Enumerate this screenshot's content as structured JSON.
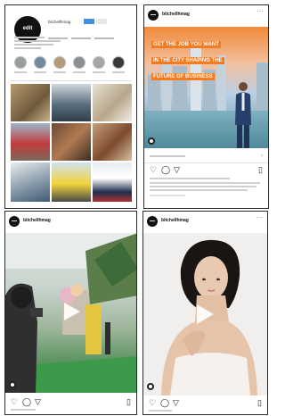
{
  "panels": {
    "profile": {
      "avatar_text": "edit",
      "handle": "bitchellhmag"
    },
    "ad_post": {
      "username": "bitchellhmag",
      "headline": [
        "GET THE JOB YOU WANT",
        "IN THE CITY SHAPING THE",
        "FUTURE OF BUSINESS"
      ],
      "cta_label": "›"
    },
    "video_post": {
      "username": "bitchellhmag"
    },
    "portrait_post": {
      "username": "bitchellhmag"
    }
  },
  "icons": {
    "heart": "♡",
    "comment": "◯",
    "share": "▽",
    "save": "▯",
    "more": "···"
  },
  "colors": {
    "accent_orange": "#f47b20",
    "accent_green": "#0b7a3e",
    "link_blue": "#3d8fe8"
  }
}
